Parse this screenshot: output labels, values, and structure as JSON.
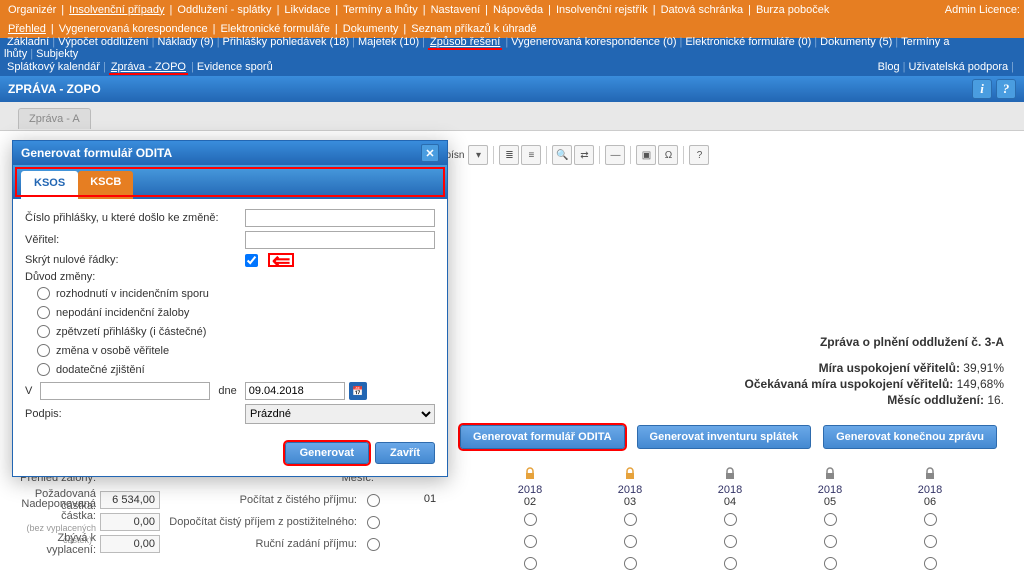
{
  "topbar": {
    "row1": [
      "Organizér",
      "Insolvenční případy",
      "Oddlužení - splátky",
      "Likvidace",
      "Termíny a lhůty",
      "Nastavení",
      "Nápověda",
      "Insolvenční rejstřík",
      "Datová schránka",
      "Burza poboček"
    ],
    "row1_underline_idx": 1,
    "row2": [
      "Přehled",
      "Vygenerovaná korespondence",
      "Elektronické formuláře",
      "Dokumenty",
      "Seznam příkazů k úhradě"
    ],
    "row2_underline_idx": 0,
    "right1": "Admin   Licence:",
    "right2": ""
  },
  "subbar": {
    "row1": [
      "Základní",
      "Výpočet oddlužení",
      "Náklady (9)",
      "Přihlášky pohledávek (18)",
      "Majetek (10)",
      "Způsob řešení",
      "Vygenerovaná korespondence (0)",
      "Elektronické formuláře (0)",
      "Dokumenty (5)",
      "Termíny a lhůty",
      "Subjekty"
    ],
    "row1_hl_idx": 5,
    "row2_left": [
      "Splátkový kalendář",
      "Zpráva - ZOPO",
      "Evidence sporů"
    ],
    "row2_left_hl_idx": 1,
    "row2_right": [
      "Blog",
      "Uživatelská podpora",
      ""
    ]
  },
  "titlebar": {
    "title": "ZPRÁVA - ZOPO"
  },
  "tab": {
    "label": "Zpráva - A"
  },
  "toolbar": {
    "font_label": "t písn"
  },
  "report": {
    "title": "Zpráva o plnění oddlužení č. 3-A",
    "rows": [
      {
        "label": "Míra uspokojení věřitelů:",
        "value": "39,91%"
      },
      {
        "label": "Očekávaná míra uspokojení věřitelů:",
        "value": "149,68%"
      },
      {
        "label": "Měsíc oddlužení:",
        "value": "16."
      }
    ]
  },
  "buttons": {
    "gen_odita": "Generovat formulář ODITA",
    "gen_inventura": "Generovat inventuru splátek",
    "gen_konecna": "Generovat konečnou zprávu"
  },
  "schedule": {
    "left_rows": [
      {
        "label1": "Přehled zálohy:",
        "label2": "Měsíc:"
      },
      {
        "label1": "Požadovaná částka:",
        "val": "6 534,00",
        "label2": "Počítat z čistého příjmu:"
      },
      {
        "label1": "Nadeponovaná částka:",
        "sub": "(bez vyplacených částek)",
        "val": "0,00",
        "label2": "Dopočítat čistý příjem z postižitelného:"
      },
      {
        "label1": "Zbývá k vyplacení:",
        "val": "0,00",
        "label2": "Ruční zadání příjmu:"
      }
    ],
    "cols": [
      {
        "year": "",
        "month": "01",
        "locked": ""
      },
      {
        "year": "2018",
        "month": "02",
        "locked": "open"
      },
      {
        "year": "2018",
        "month": "03",
        "locked": "open"
      },
      {
        "year": "2018",
        "month": "04",
        "locked": "closed"
      },
      {
        "year": "2018",
        "month": "05",
        "locked": "closed"
      },
      {
        "year": "2018",
        "month": "06",
        "locked": "closed"
      }
    ]
  },
  "modal": {
    "title": "Generovat formulář ODITA",
    "tabs": {
      "active": "KSOS",
      "inactive": "KSCB"
    },
    "fields": {
      "cislo_label": "Číslo přihlášky, u které došlo ke změně:",
      "veritel_label": "Věřitel:",
      "skryt_label": "Skrýt nulové řádky:",
      "duvod_label": "Důvod změny:"
    },
    "reasons": [
      "rozhodnutí v incidenčním sporu",
      "nepodání incidenční žaloby",
      "zpětvzetí přihlášky (i částečné)",
      "změna v osobě věřitele",
      "dodatečné zjištění"
    ],
    "v_label": "V",
    "dne_label": "dne",
    "date_value": "09.04.2018",
    "podpis_label": "Podpis:",
    "podpis_value": "Prázdné",
    "btn_generate": "Generovat",
    "btn_close": "Zavřít"
  }
}
